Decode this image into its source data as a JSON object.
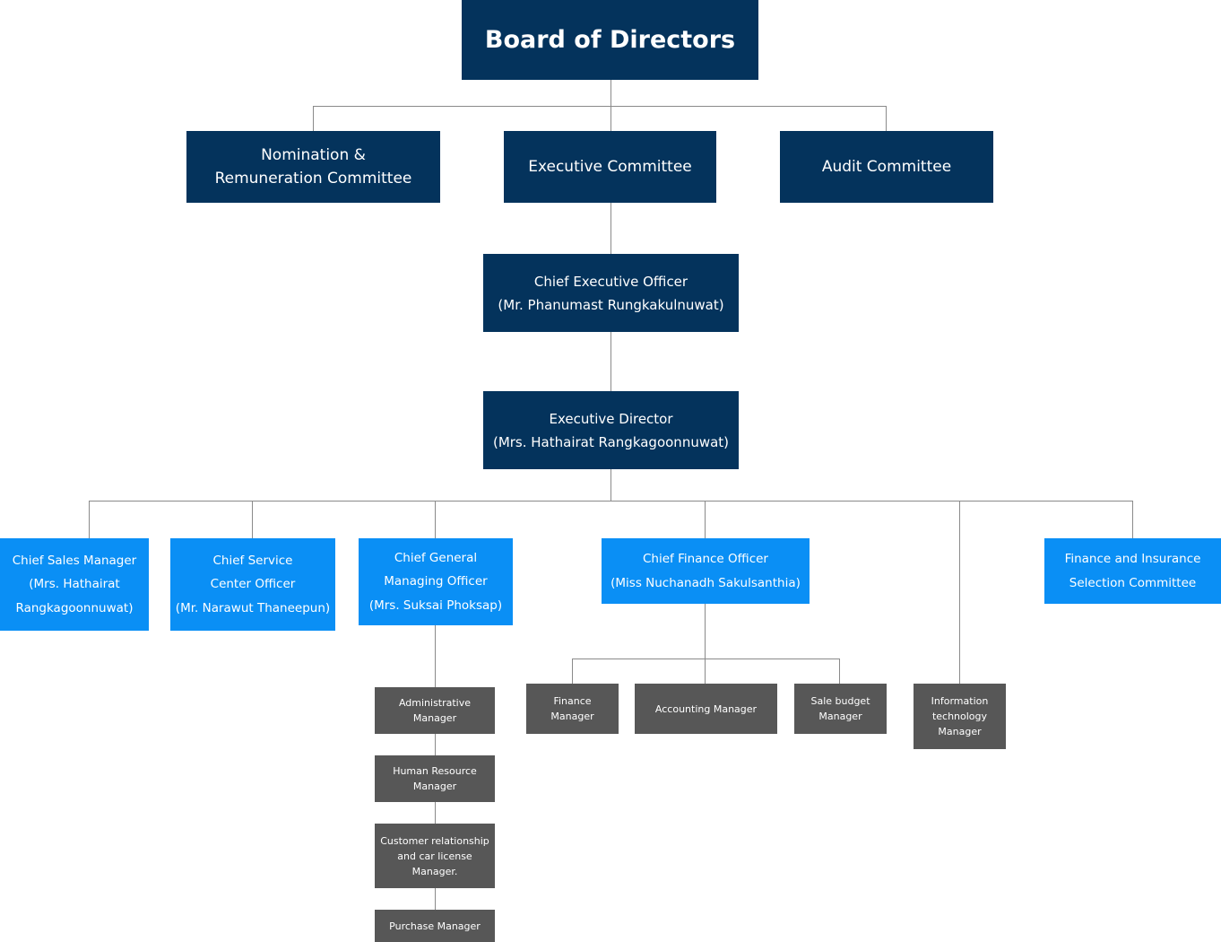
{
  "chart": {
    "title": "Board of Directors",
    "colors": {
      "top_level": "#04335c",
      "departments": "#0a8ff5",
      "managers": "#575757",
      "connectors": "#8a8a8a"
    },
    "committees": [
      {
        "label": "Nomination &\nRemuneration Committee"
      },
      {
        "label": "Executive Committee"
      },
      {
        "label": "Audit Committee"
      }
    ],
    "ceo": {
      "label": "Chief Executive Officer\n(Mr. Phanumast Rungkakulnuwat)"
    },
    "executive_director": {
      "label": "Executive Director\n(Mrs. Hathairat Rangkagoonnuwat)"
    },
    "departments": [
      {
        "label": "Chief Sales Manager\n(Mrs. Hathairat\nRangkagoonnuwat)"
      },
      {
        "label": "Chief Service\nCenter Officer\n(Mr. Narawut Thaneepun)"
      },
      {
        "label": "Chief General\nManaging Officer\n(Mrs. Suksai Phoksap)"
      },
      {
        "label": "Chief Finance Officer\n(Miss Nuchanadh Sakulsanthia)"
      },
      {
        "label": "Finance and Insurance\nSelection Committee"
      }
    ],
    "general_managing_reports": [
      {
        "label": "Administrative\nManager"
      },
      {
        "label": "Human Resource\nManager"
      },
      {
        "label": "Customer relationship\nand car license\nManager."
      },
      {
        "label": "Purchase Manager"
      }
    ],
    "finance_reports": [
      {
        "label": "Finance\nManager"
      },
      {
        "label": "Accounting Manager"
      },
      {
        "label": "Sale budget\nManager"
      }
    ],
    "it_manager": {
      "label": "Information\ntechnology\nManager"
    }
  }
}
